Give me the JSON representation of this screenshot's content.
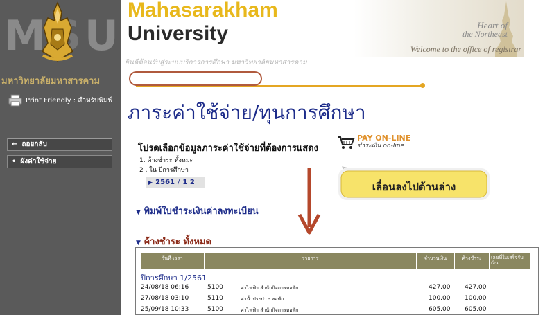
{
  "sidebar": {
    "logo_letters": [
      "M",
      "S",
      "U"
    ],
    "university_thai": "มหาวิทยาลัยมหาสารคาม",
    "print_friendly": "Print Friendly : สำหรับพิมพ์",
    "nav": [
      {
        "label": "ถอยกลับ",
        "icon": "back-arrow-icon"
      },
      {
        "label": "ผังค่าใช้จ่าย",
        "icon": "bullet-icon"
      }
    ]
  },
  "header": {
    "brand_line1": "Mahasarakham",
    "brand_line2": "University",
    "tag_line1": "Heart of",
    "tag_line2": "the Northeast",
    "welcome": "Welcome to the office of registrar",
    "subtitle": "ยินดีต้อนรับสู่ระบบบริการการศึกษา มหาวิทยาลัยมหาสารคาม"
  },
  "main": {
    "page_title": "ภาระค่าใช้จ่าย/ทุนการศึกษา",
    "prompt": "โปรดเลือกข้อมูลภาระค่าใช้จ่ายที่ต้องการแสดง",
    "pay_online": {
      "title": "PAY ON-LINE",
      "subtitle": "ชำระเงิน on-line"
    },
    "options": [
      "1. ค้างชำระ ทั้งหมด",
      "2 . ใน ปีการศึกษา"
    ],
    "year_selector": {
      "year": "2561",
      "separator": " / ",
      "term": "1 2"
    },
    "print_section": "พิมพ์ใบชำระเงินค่าลงทะเบียน",
    "owing_section": "ค้างชำระ ทั้งหมด",
    "callout_text": "เลื่อนลงไปด้านล่าง"
  },
  "table": {
    "columns": [
      "วันที่-เวลา",
      "รายการ",
      "จำนวนเงิน",
      "ค้างชำระ",
      "เลขที่ใบเสร็จรับเงิน"
    ],
    "group_label": "ปีการศึกษา 1/2561",
    "rows": [
      {
        "datetime": "24/08/18 06:16",
        "code": "5100",
        "desc": "ค่าไฟฟ้า สำนักกิจการหอพัก",
        "amount": "427.00",
        "owing": "427.00"
      },
      {
        "datetime": "27/08/18 03:10",
        "code": "5110",
        "desc": "ค่าน้ำประปา - หอพัก",
        "amount": "100.00",
        "owing": "100.00"
      },
      {
        "datetime": "25/09/18 10:33",
        "code": "5100",
        "desc": "ค่าไฟฟ้า สำนักกิจการหอพัก",
        "amount": "605.00",
        "owing": "605.00"
      }
    ]
  },
  "colors": {
    "sidebar_bg": "#5a5a5a",
    "brand_gold": "#e8b81c",
    "title_blue": "#1d2c8a",
    "owing_red": "#8b2a18",
    "table_header": "#8a8760",
    "annotation_red": "#b05a3e",
    "callout_yellow": "#f7e36a"
  }
}
